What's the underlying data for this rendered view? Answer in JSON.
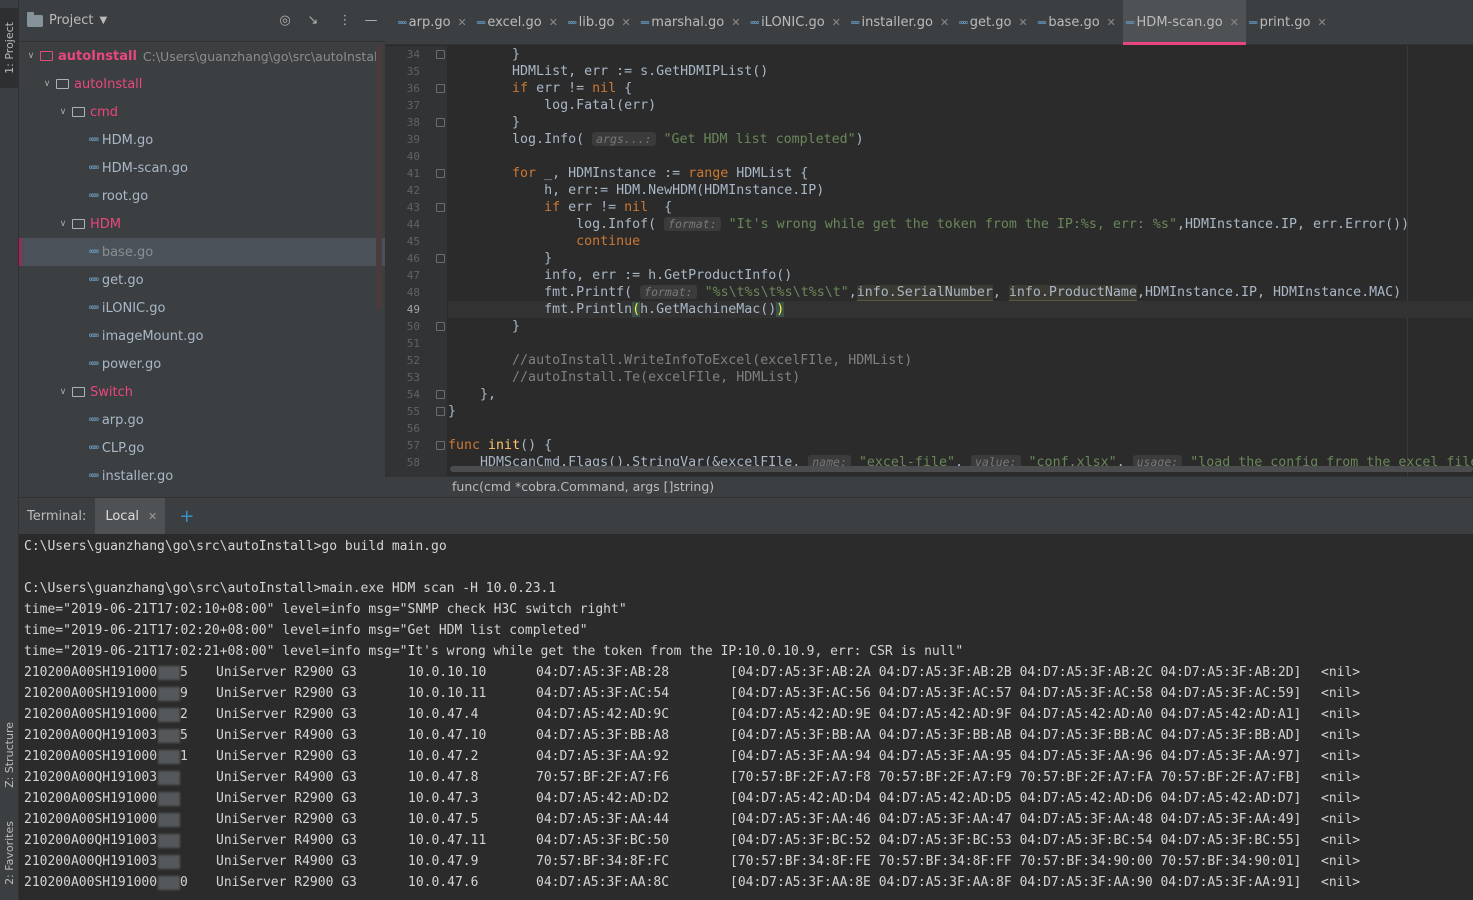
{
  "toolstrip": {
    "project_tab": "1: Project",
    "structure_tab": "Z: Structure",
    "favorites_tab": "2: Favorites"
  },
  "project": {
    "title": "Project",
    "tree": [
      {
        "label": "autoInstall",
        "extra": "C:\\Users\\guanzhang\\go\\src\\autoInstall",
        "type": "root"
      },
      {
        "label": "autoInstall",
        "type": "dir"
      },
      {
        "label": "cmd",
        "type": "dir"
      },
      {
        "label": "HDM.go",
        "type": "file"
      },
      {
        "label": "HDM-scan.go",
        "type": "file"
      },
      {
        "label": "root.go",
        "type": "file"
      },
      {
        "label": "HDM",
        "type": "dir"
      },
      {
        "label": "base.go",
        "type": "file",
        "selected": true
      },
      {
        "label": "get.go",
        "type": "file"
      },
      {
        "label": "iLONIC.go",
        "type": "file"
      },
      {
        "label": "imageMount.go",
        "type": "file"
      },
      {
        "label": "power.go",
        "type": "file"
      },
      {
        "label": "Switch",
        "type": "dir"
      },
      {
        "label": "arp.go",
        "type": "file"
      },
      {
        "label": "CLP.go",
        "type": "file"
      },
      {
        "label": "installer.go",
        "type": "file"
      }
    ]
  },
  "tabs": [
    "arp.go",
    "excel.go",
    "lib.go",
    "marshal.go",
    "iLONIC.go",
    "installer.go",
    "get.go",
    "base.go",
    "HDM-scan.go",
    "print.go"
  ],
  "active_tab": "HDM-scan.go",
  "editor": {
    "line_numbers": [
      "34",
      "35",
      "36",
      "37",
      "38",
      "39",
      "40",
      "41",
      "42",
      "43",
      "44",
      "45",
      "46",
      "47",
      "48",
      "49",
      "50",
      "51",
      "52",
      "53",
      "54",
      "55",
      "56",
      "57",
      "58"
    ],
    "current_line": "49",
    "breadcrumb": "func(cmd *cobra.Command, args []string)"
  },
  "terminal": {
    "label": "Terminal:",
    "tab": "Local",
    "lines": [
      "C:\\Users\\guanzhang\\go\\src\\autoInstall>go build main.go",
      "",
      "C:\\Users\\guanzhang\\go\\src\\autoInstall>main.exe HDM scan -H 10.0.23.1",
      "time=\"2019-06-21T17:02:10+08:00\" level=info msg=\"SNMP check H3C switch right\"",
      "time=\"2019-06-21T17:02:20+08:00\" level=info msg=\"Get HDM list completed\"",
      "time=\"2019-06-21T17:02:21+08:00\" level=info msg=\"It's wrong while get the token from the IP:10.0.10.9, err: CSR is null\""
    ],
    "rows": [
      {
        "serial": "210200A00SH191000",
        "tail": "5",
        "model": "UniServer R2900 G3",
        "ip": "10.0.10.10",
        "mac": "04:D7:A5:3F:AB:28",
        "macs": "[04:D7:A5:3F:AB:2A 04:D7:A5:3F:AB:2B 04:D7:A5:3F:AB:2C 04:D7:A5:3F:AB:2D]",
        "err": "<nil>"
      },
      {
        "serial": "210200A00SH191000",
        "tail": "9",
        "model": "UniServer R2900 G3",
        "ip": "10.0.10.11",
        "mac": "04:D7:A5:3F:AC:54",
        "macs": "[04:D7:A5:3F:AC:56 04:D7:A5:3F:AC:57 04:D7:A5:3F:AC:58 04:D7:A5:3F:AC:59]",
        "err": "<nil>"
      },
      {
        "serial": "210200A00SH191000",
        "tail": "2",
        "model": "UniServer R2900 G3",
        "ip": "10.0.47.4",
        "mac": "04:D7:A5:42:AD:9C",
        "macs": "[04:D7:A5:42:AD:9E 04:D7:A5:42:AD:9F 04:D7:A5:42:AD:A0 04:D7:A5:42:AD:A1]",
        "err": "<nil>"
      },
      {
        "serial": "210200A00QH191003",
        "tail": "5",
        "model": "UniServer R4900 G3",
        "ip": "10.0.47.10",
        "mac": "04:D7:A5:3F:BB:A8",
        "macs": "[04:D7:A5:3F:BB:AA 04:D7:A5:3F:BB:AB 04:D7:A5:3F:BB:AC 04:D7:A5:3F:BB:AD]",
        "err": "<nil>"
      },
      {
        "serial": "210200A00SH191000",
        "tail": "1",
        "model": "UniServer R2900 G3",
        "ip": "10.0.47.2",
        "mac": "04:D7:A5:3F:AA:92",
        "macs": "[04:D7:A5:3F:AA:94 04:D7:A5:3F:AA:95 04:D7:A5:3F:AA:96 04:D7:A5:3F:AA:97]",
        "err": "<nil>"
      },
      {
        "serial": "210200A00QH191003",
        "tail": "",
        "model": "UniServer R4900 G3",
        "ip": "10.0.47.8",
        "mac": "70:57:BF:2F:A7:F6",
        "macs": "[70:57:BF:2F:A7:F8 70:57:BF:2F:A7:F9 70:57:BF:2F:A7:FA 70:57:BF:2F:A7:FB]",
        "err": "<nil>"
      },
      {
        "serial": "210200A00SH191000",
        "tail": "",
        "model": "UniServer R2900 G3",
        "ip": "10.0.47.3",
        "mac": "04:D7:A5:42:AD:D2",
        "macs": "[04:D7:A5:42:AD:D4 04:D7:A5:42:AD:D5 04:D7:A5:42:AD:D6 04:D7:A5:42:AD:D7]",
        "err": "<nil>"
      },
      {
        "serial": "210200A00SH191000",
        "tail": "",
        "model": "UniServer R2900 G3",
        "ip": "10.0.47.5",
        "mac": "04:D7:A5:3F:AA:44",
        "macs": "[04:D7:A5:3F:AA:46 04:D7:A5:3F:AA:47 04:D7:A5:3F:AA:48 04:D7:A5:3F:AA:49]",
        "err": "<nil>"
      },
      {
        "serial": "210200A00QH191003",
        "tail": "",
        "model": "UniServer R4900 G3",
        "ip": "10.0.47.11",
        "mac": "04:D7:A5:3F:BC:50",
        "macs": "[04:D7:A5:3F:BC:52 04:D7:A5:3F:BC:53 04:D7:A5:3F:BC:54 04:D7:A5:3F:BC:55]",
        "err": "<nil>"
      },
      {
        "serial": "210200A00QH191003",
        "tail": "",
        "model": "UniServer R4900 G3",
        "ip": "10.0.47.9",
        "mac": "70:57:BF:34:8F:FC",
        "macs": "[70:57:BF:34:8F:FE 70:57:BF:34:8F:FF 70:57:BF:34:90:00 70:57:BF:34:90:01]",
        "err": "<nil>"
      },
      {
        "serial": "210200A00SH191000",
        "tail": "0",
        "model": "UniServer R2900 G3",
        "ip": "10.0.47.6",
        "mac": "04:D7:A5:3F:AA:8C",
        "macs": "[04:D7:A5:3F:AA:8E 04:D7:A5:3F:AA:8F 04:D7:A5:3F:AA:90 04:D7:A5:3F:AA:91]",
        "err": "<nil>"
      }
    ]
  },
  "colors": {
    "accent": "#e9467f",
    "keyword": "#cc7832",
    "string": "#6a8759",
    "function": "#ffc66d"
  }
}
